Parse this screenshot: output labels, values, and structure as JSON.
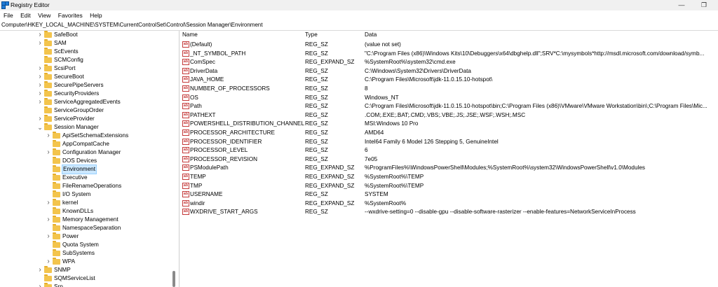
{
  "window": {
    "title": "Registry Editor",
    "minimize": "—",
    "restore": "❐"
  },
  "menu": [
    "File",
    "Edit",
    "View",
    "Favorites",
    "Help"
  ],
  "address": "Computer\\HKEY_LOCAL_MACHINE\\SYSTEM\\CurrentControlSet\\Control\\Session Manager\\Environment",
  "tree": [
    {
      "label": "SafeBoot",
      "expandable": true
    },
    {
      "label": "SAM",
      "expandable": true
    },
    {
      "label": "ScEvents",
      "expandable": false
    },
    {
      "label": "SCMConfig",
      "expandable": false
    },
    {
      "label": "ScsiPort",
      "expandable": true
    },
    {
      "label": "SecureBoot",
      "expandable": true
    },
    {
      "label": "SecurePipeServers",
      "expandable": true
    },
    {
      "label": "SecurityProviders",
      "expandable": true
    },
    {
      "label": "ServiceAggregatedEvents",
      "expandable": true
    },
    {
      "label": "ServiceGroupOrder",
      "expandable": false
    },
    {
      "label": "ServiceProvider",
      "expandable": true
    },
    {
      "label": "Session Manager",
      "expandable": true,
      "expanded": true
    },
    {
      "label": "ApiSetSchemaExtensions",
      "expandable": true,
      "child": true
    },
    {
      "label": "AppCompatCache",
      "expandable": false,
      "child": true
    },
    {
      "label": "Configuration Manager",
      "expandable": true,
      "child": true
    },
    {
      "label": "DOS Devices",
      "expandable": false,
      "child": true
    },
    {
      "label": "Environment",
      "expandable": false,
      "child": true,
      "selected": true
    },
    {
      "label": "Executive",
      "expandable": false,
      "child": true
    },
    {
      "label": "FileRenameOperations",
      "expandable": false,
      "child": true
    },
    {
      "label": "I/O System",
      "expandable": false,
      "child": true
    },
    {
      "label": "kernel",
      "expandable": true,
      "child": true
    },
    {
      "label": "KnownDLLs",
      "expandable": false,
      "child": true
    },
    {
      "label": "Memory Management",
      "expandable": true,
      "child": true
    },
    {
      "label": "NamespaceSeparation",
      "expandable": false,
      "child": true
    },
    {
      "label": "Power",
      "expandable": true,
      "child": true
    },
    {
      "label": "Quota System",
      "expandable": false,
      "child": true
    },
    {
      "label": "SubSystems",
      "expandable": false,
      "child": true
    },
    {
      "label": "WPA",
      "expandable": true,
      "child": true
    },
    {
      "label": "SNMP",
      "expandable": true
    },
    {
      "label": "SQMServiceList",
      "expandable": false
    },
    {
      "label": "Srp",
      "expandable": true
    }
  ],
  "columns": {
    "name": "Name",
    "type": "Type",
    "data": "Data"
  },
  "value_icon_text": "ab",
  "values": [
    {
      "name": "(Default)",
      "type": "REG_SZ",
      "data": "(value not set)"
    },
    {
      "name": "_NT_SYMBOL_PATH",
      "type": "REG_SZ",
      "data": "\"C:\\Program Files (x86)\\Windows Kits\\10\\Debuggers\\x64\\dbghelp.dll\";SRV*C:\\mysymbols*http://msdl.microsoft.com/download/symb..."
    },
    {
      "name": "ComSpec",
      "type": "REG_EXPAND_SZ",
      "data": "%SystemRoot%\\system32\\cmd.exe"
    },
    {
      "name": "DriverData",
      "type": "REG_SZ",
      "data": "C:\\Windows\\System32\\Drivers\\DriverData"
    },
    {
      "name": "JAVA_HOME",
      "type": "REG_SZ",
      "data": "C:\\Program Files\\Microsoft\\jdk-11.0.15.10-hotspot\\"
    },
    {
      "name": "NUMBER_OF_PROCESSORS",
      "type": "REG_SZ",
      "data": "8"
    },
    {
      "name": "OS",
      "type": "REG_SZ",
      "data": "Windows_NT"
    },
    {
      "name": "Path",
      "type": "REG_SZ",
      "data": "C:\\Program Files\\Microsoft\\jdk-11.0.15.10-hotspot\\bin;C:\\Program Files (x86)\\VMware\\VMware Workstation\\bin\\;C:\\Program Files\\Mic..."
    },
    {
      "name": "PATHEXT",
      "type": "REG_SZ",
      "data": ".COM;.EXE;.BAT;.CMD;.VBS;.VBE;.JS;.JSE;.WSF;.WSH;.MSC"
    },
    {
      "name": "POWERSHELL_DISTRIBUTION_CHANNEL",
      "type": "REG_SZ",
      "data": "MSI:Windows 10 Pro"
    },
    {
      "name": "PROCESSOR_ARCHITECTURE",
      "type": "REG_SZ",
      "data": "AMD64"
    },
    {
      "name": "PROCESSOR_IDENTIFIER",
      "type": "REG_SZ",
      "data": "Intel64 Family 6 Model 126 Stepping 5, GenuineIntel"
    },
    {
      "name": "PROCESSOR_LEVEL",
      "type": "REG_SZ",
      "data": "6"
    },
    {
      "name": "PROCESSOR_REVISION",
      "type": "REG_SZ",
      "data": "7e05"
    },
    {
      "name": "PSModulePath",
      "type": "REG_EXPAND_SZ",
      "data": "%ProgramFiles%\\WindowsPowerShell\\Modules;%SystemRoot%\\system32\\WindowsPowerShell\\v1.0\\Modules"
    },
    {
      "name": "TEMP",
      "type": "REG_EXPAND_SZ",
      "data": "%SystemRoot%\\TEMP"
    },
    {
      "name": "TMP",
      "type": "REG_EXPAND_SZ",
      "data": "%SystemRoot%\\TEMP"
    },
    {
      "name": "USERNAME",
      "type": "REG_SZ",
      "data": "SYSTEM"
    },
    {
      "name": "windir",
      "type": "REG_EXPAND_SZ",
      "data": "%SystemRoot%"
    },
    {
      "name": "WXDRIVE_START_ARGS",
      "type": "REG_SZ",
      "data": "--wxdrive-setting=0 --disable-gpu --disable-software-rasterizer --enable-features=NetworkServiceInProcess"
    }
  ]
}
